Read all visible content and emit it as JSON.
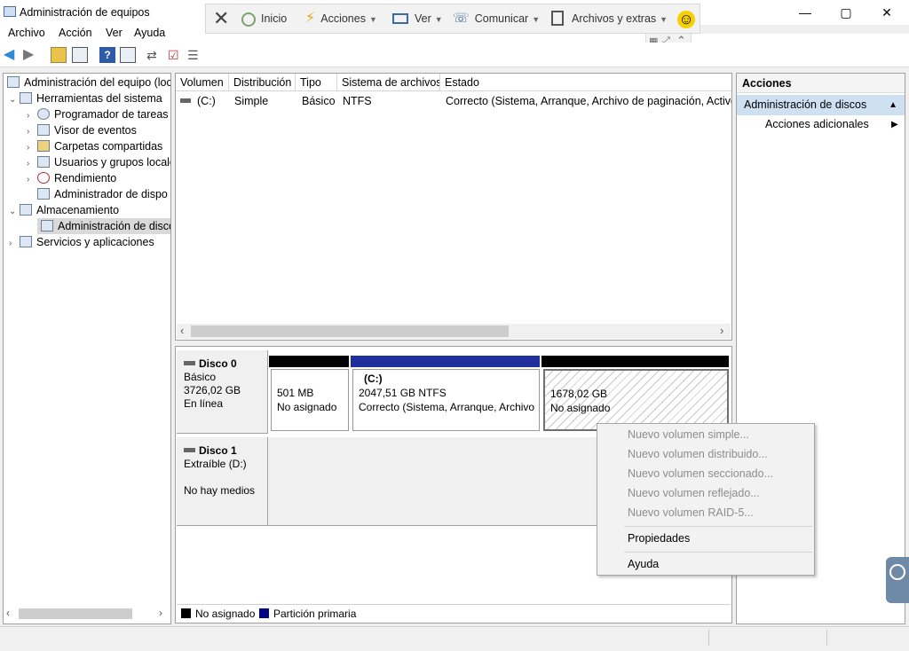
{
  "window": {
    "title": "Administración de equipos",
    "controls": {
      "minimize": "—",
      "maximize": "▢",
      "close": "✕"
    }
  },
  "menubar": {
    "items": [
      "Archivo",
      "Acción",
      "Ver",
      "Ayuda"
    ]
  },
  "remote_toolbar": {
    "close": "✕",
    "inicio": "Inicio",
    "acciones": "Acciones",
    "ver": "Ver",
    "comunicar": "Comunicar",
    "archivos": "Archivos y extras",
    "smiley": "☺"
  },
  "tree": {
    "root": "Administración del equipo (loc",
    "herramientas": "Herramientas del sistema",
    "programador": "Programador de tareas",
    "visor": "Visor de eventos",
    "carpetas": "Carpetas compartidas",
    "usuarios": "Usuarios y grupos locale",
    "rendimiento": "Rendimiento",
    "admin_dispositivos": "Administrador de dispo",
    "almacenamiento": "Almacenamiento",
    "admin_discos": "Administración de disco",
    "servicios": "Servicios y aplicaciones"
  },
  "volumes": {
    "headers": [
      "Volumen",
      "Distribución",
      "Tipo",
      "Sistema de archivos",
      "Estado"
    ],
    "rows": [
      {
        "volumen": "(C:)",
        "distribucion": "Simple",
        "tipo": "Básico",
        "sistema": "NTFS",
        "estado": "Correcto (Sistema, Arranque, Archivo de paginación, Activo, V"
      }
    ]
  },
  "disks": {
    "disk0": {
      "name": "Disco 0",
      "type": "Básico",
      "size": "3726,02 GB",
      "status": "En línea",
      "partitions": [
        {
          "line1": "501 MB",
          "line2": "No asignado"
        },
        {
          "title": "(C:)",
          "line1": "2047,51 GB NTFS",
          "line2": "Correcto (Sistema, Arranque, Archivo"
        },
        {
          "line1": "1678,02 GB",
          "line2": "No asignado"
        }
      ]
    },
    "disk1": {
      "name": "Disco 1",
      "type": "Extraíble (D:)",
      "status": "No hay medios"
    }
  },
  "legend": {
    "unallocated": "No asignado",
    "primary": "Partición primaria"
  },
  "actions": {
    "header": "Acciones",
    "section": "Administración de discos",
    "more": "Acciones adicionales"
  },
  "context_menu": {
    "items": [
      "Nuevo volumen simple...",
      "Nuevo volumen distribuido...",
      "Nuevo volumen seccionado...",
      "Nuevo volumen reflejado...",
      "Nuevo volumen RAID-5..."
    ],
    "properties": "Propiedades",
    "help": "Ayuda"
  },
  "colors": {
    "primary_partition": "#000080",
    "unallocated": "#000000",
    "selection": "#cfe0f2"
  }
}
